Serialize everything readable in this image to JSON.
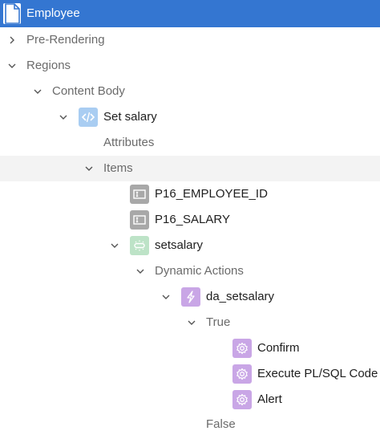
{
  "tree": {
    "page": {
      "label": "Employee",
      "icon": "page-icon",
      "color": "#3476d1"
    },
    "pre_rendering": {
      "label": "Pre-Rendering"
    },
    "regions": {
      "label": "Regions"
    },
    "content_body": {
      "label": "Content Body"
    },
    "set_salary": {
      "label": "Set salary",
      "icon": "region-icon"
    },
    "attributes": {
      "label": "Attributes"
    },
    "items": {
      "label": "Items"
    },
    "item_1": {
      "label": "P16_EMPLOYEE_ID",
      "icon": "page-item-icon"
    },
    "item_2": {
      "label": "P16_SALARY",
      "icon": "page-item-icon"
    },
    "button": {
      "label": "setsalary",
      "icon": "button-icon"
    },
    "dynamic_actions": {
      "label": "Dynamic Actions"
    },
    "da": {
      "label": "da_setsalary",
      "icon": "lightning-icon"
    },
    "true_branch": {
      "label": "True"
    },
    "actions": [
      {
        "label": "Confirm",
        "icon": "gear-icon"
      },
      {
        "label": "Execute PL/SQL Code",
        "icon": "gear-icon"
      },
      {
        "label": "Alert",
        "icon": "gear-icon"
      }
    ],
    "false_branch": {
      "label": "False"
    }
  }
}
